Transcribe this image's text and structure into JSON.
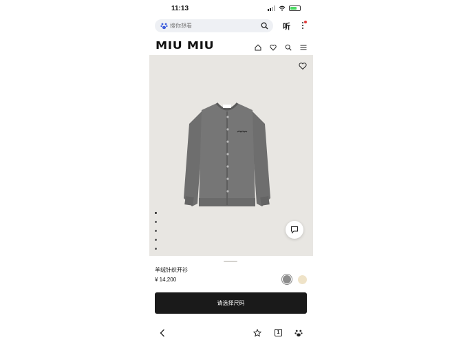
{
  "status_bar": {
    "time": "11:13"
  },
  "browser": {
    "search_placeholder": "搜你想看",
    "listen_label": "听"
  },
  "site": {
    "brand": "MIU MIU"
  },
  "product": {
    "name": "羊绒针织开衫",
    "price": "¥ 14,200",
    "image_count": 5,
    "active_image": 1,
    "colors": [
      {
        "name": "grey",
        "hex": "#8c8c8c",
        "selected": true
      },
      {
        "name": "cream",
        "hex": "#efe3c8",
        "selected": false
      }
    ]
  },
  "cta": {
    "label": "请选择尺码"
  },
  "bottom_nav": {
    "tab_count": "1"
  }
}
